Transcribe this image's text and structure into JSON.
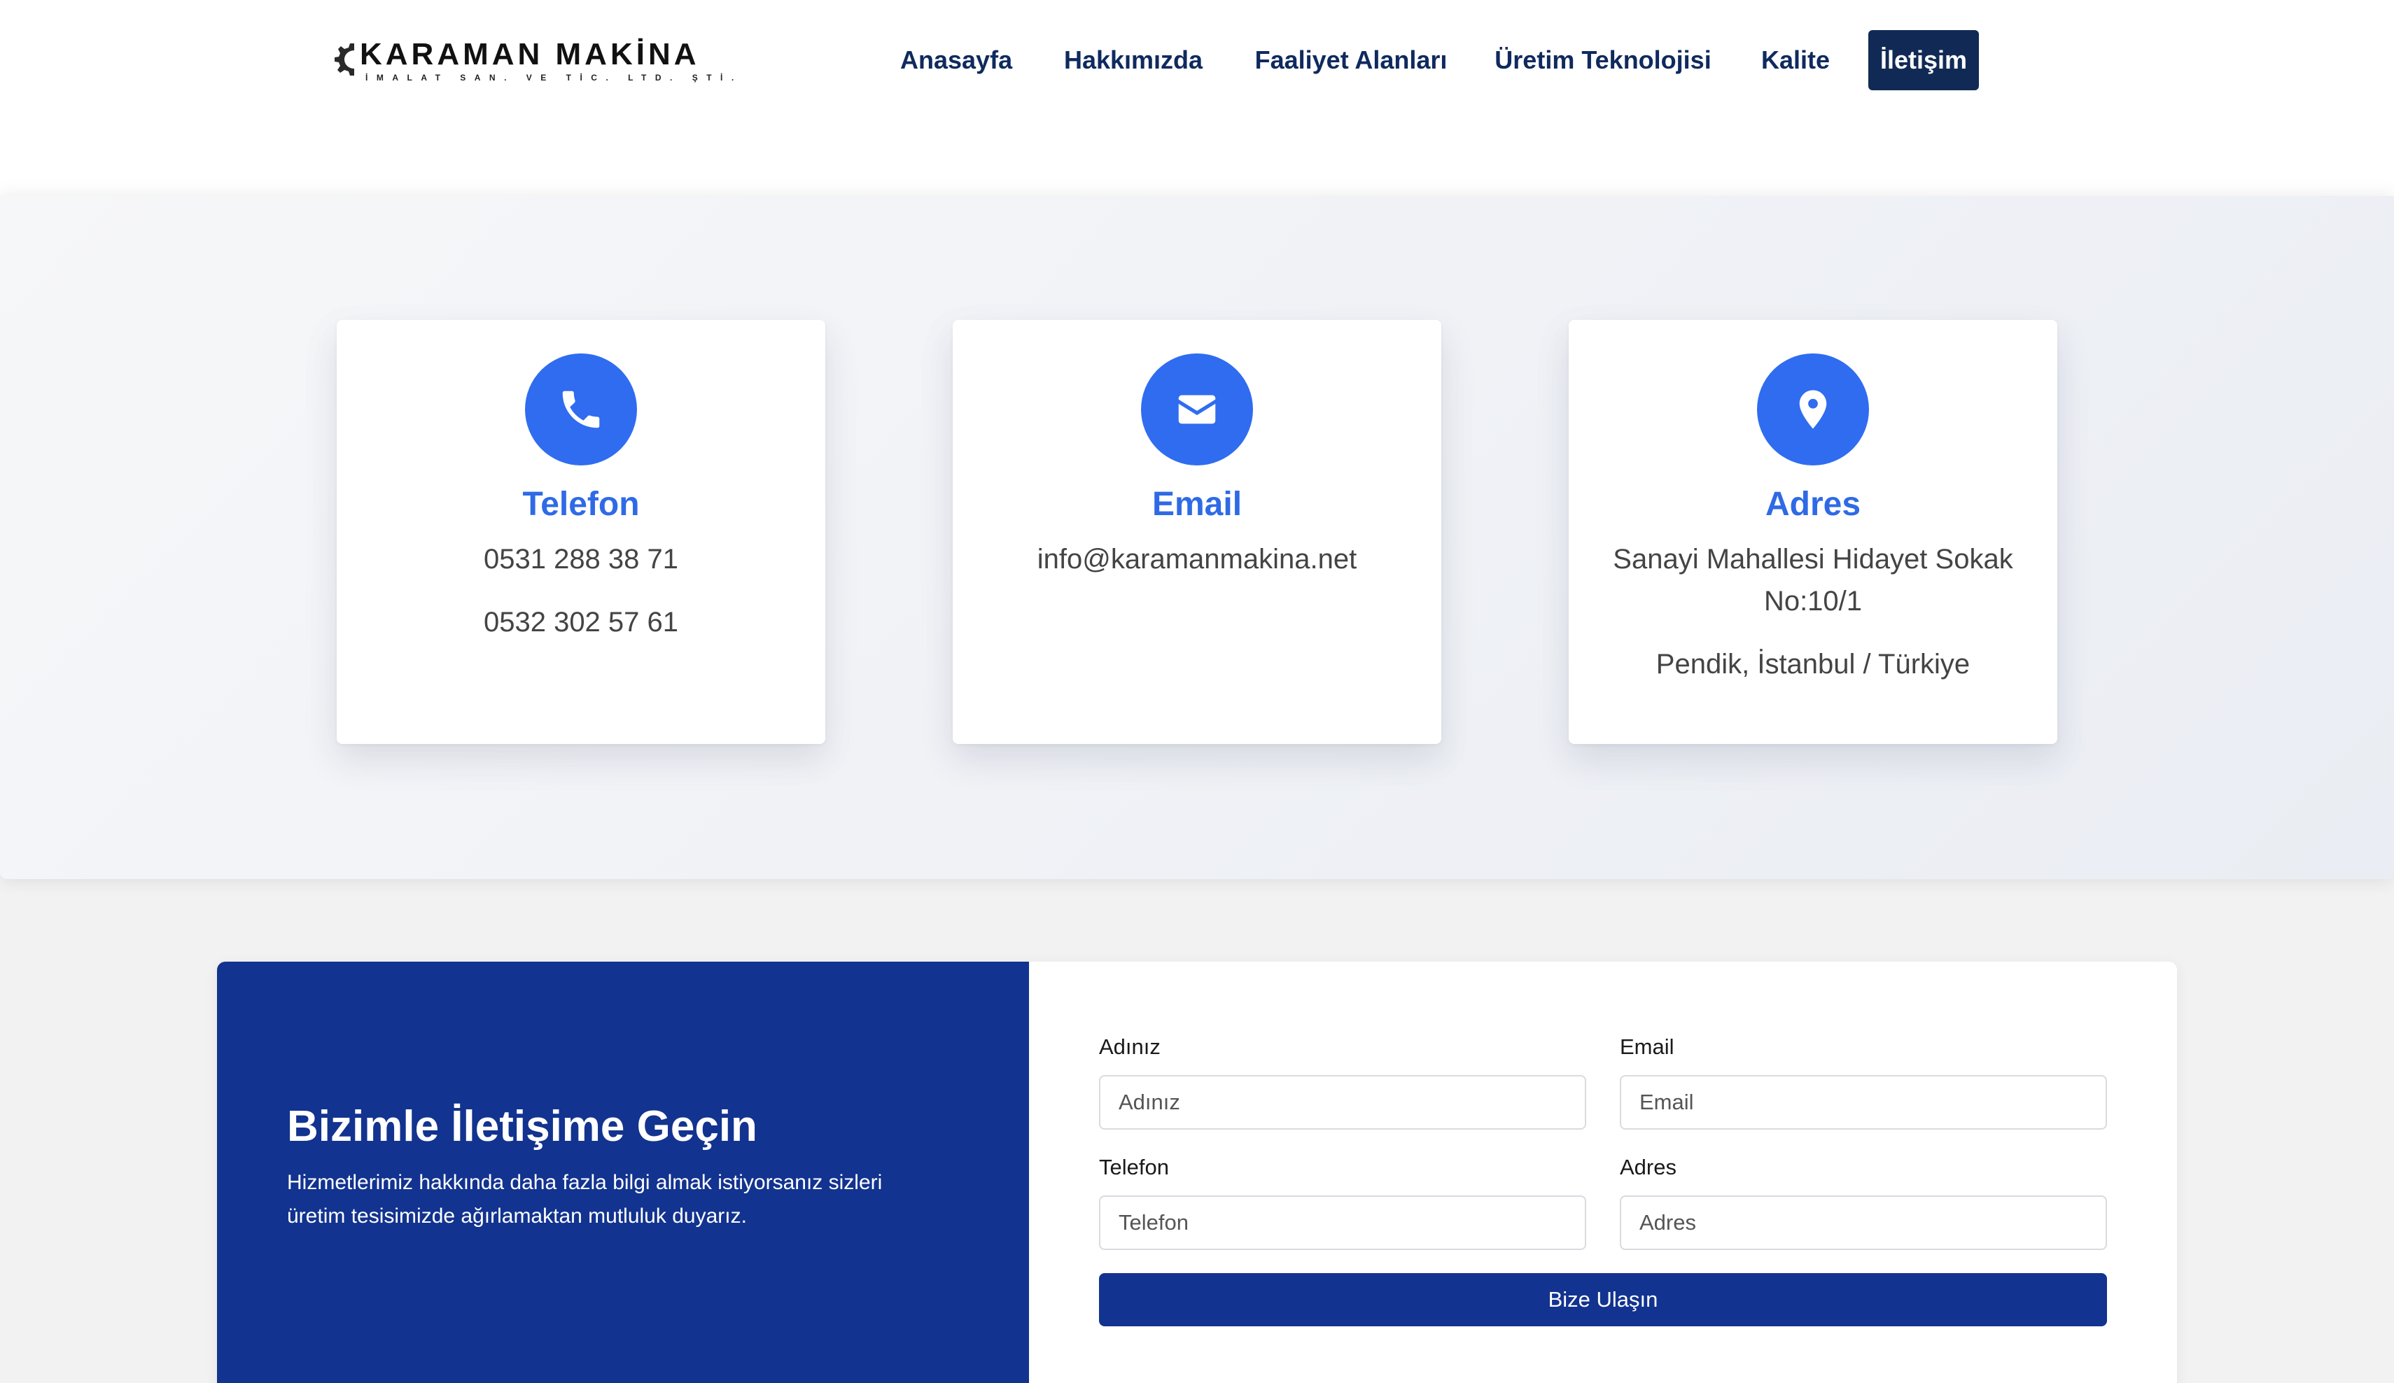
{
  "header": {
    "logo": {
      "name": "KARAMAN MAKİNA",
      "subtitle": "İMALAT SAN. VE TİC. LTD. ŞTİ."
    },
    "nav": [
      {
        "label": "Anasayfa"
      },
      {
        "label": "Hakkımızda"
      },
      {
        "label": "Faaliyet Alanları"
      },
      {
        "label": "Üretim Teknolojisi"
      },
      {
        "label": "Kalite"
      },
      {
        "label": "İletişim",
        "active": true
      }
    ]
  },
  "contact_cards": [
    {
      "icon": "phone-icon",
      "title": "Telefon",
      "lines": [
        "0531 288 38 71",
        "0532 302 57 61"
      ]
    },
    {
      "icon": "email-icon",
      "title": "Email",
      "lines": [
        "info@karamanmakina.net"
      ]
    },
    {
      "icon": "location-pin-icon",
      "title": "Adres",
      "lines": [
        "Sanayi Mahallesi Hidayet Sokak No:10/1",
        "Pendik, İstanbul / Türkiye"
      ]
    }
  ],
  "contact_form": {
    "heading": "Bizimle İletişime Geçin",
    "description": "Hizmetlerimiz hakkında daha fazla bilgi almak istiyorsanız sizleri üretim tesisimizde ağırlamaktan mutluluk duyarız.",
    "fields": [
      {
        "label": "Adınız",
        "placeholder": "Adınız"
      },
      {
        "label": "Email",
        "placeholder": "Email"
      },
      {
        "label": "Telefon",
        "placeholder": "Telefon"
      },
      {
        "label": "Adres",
        "placeholder": "Adres"
      }
    ],
    "submit_label": "Bize Ulaşın"
  },
  "colors": {
    "primary_navy": "#12338f",
    "accent_blue": "#2f6cf0",
    "nav_text": "#0f2a5e",
    "nav_active_bg": "#112a55"
  }
}
